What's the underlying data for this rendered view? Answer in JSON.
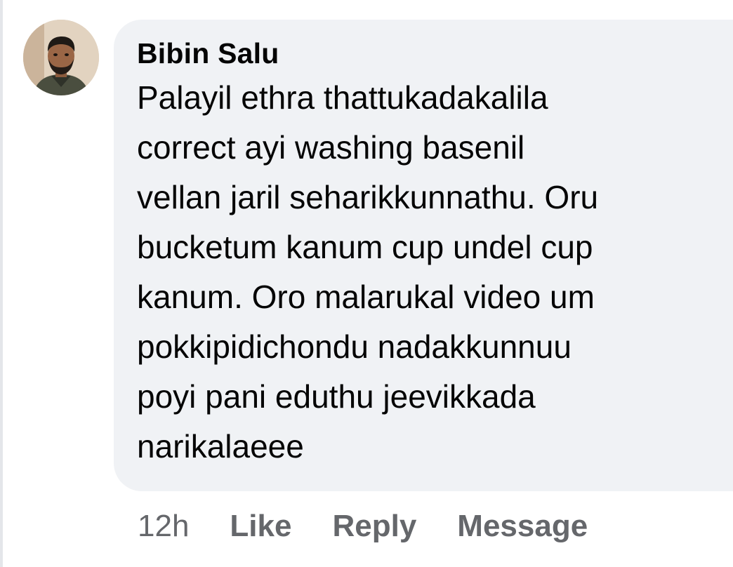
{
  "comment": {
    "author": "Bibin Salu",
    "text": "Palayil ethra thattukadakalila\ncorrect ayi washing basenil\nvellan jaril seharikkunnathu. Oru\nbucketum kanum cup undel cup\nkanum. Oro malarukal video um\npokkipidichondu nadakkunnuu\npoyi pani eduthu jeevikkada\nnarikalaeee",
    "avatar_icon": "profile-photo"
  },
  "actions": {
    "time": "12h",
    "like_label": "Like",
    "reply_label": "Reply",
    "message_label": "Message"
  },
  "colors": {
    "bubble_bg": "#f0f2f5",
    "text": "#050505",
    "secondary_text": "#65676b"
  }
}
